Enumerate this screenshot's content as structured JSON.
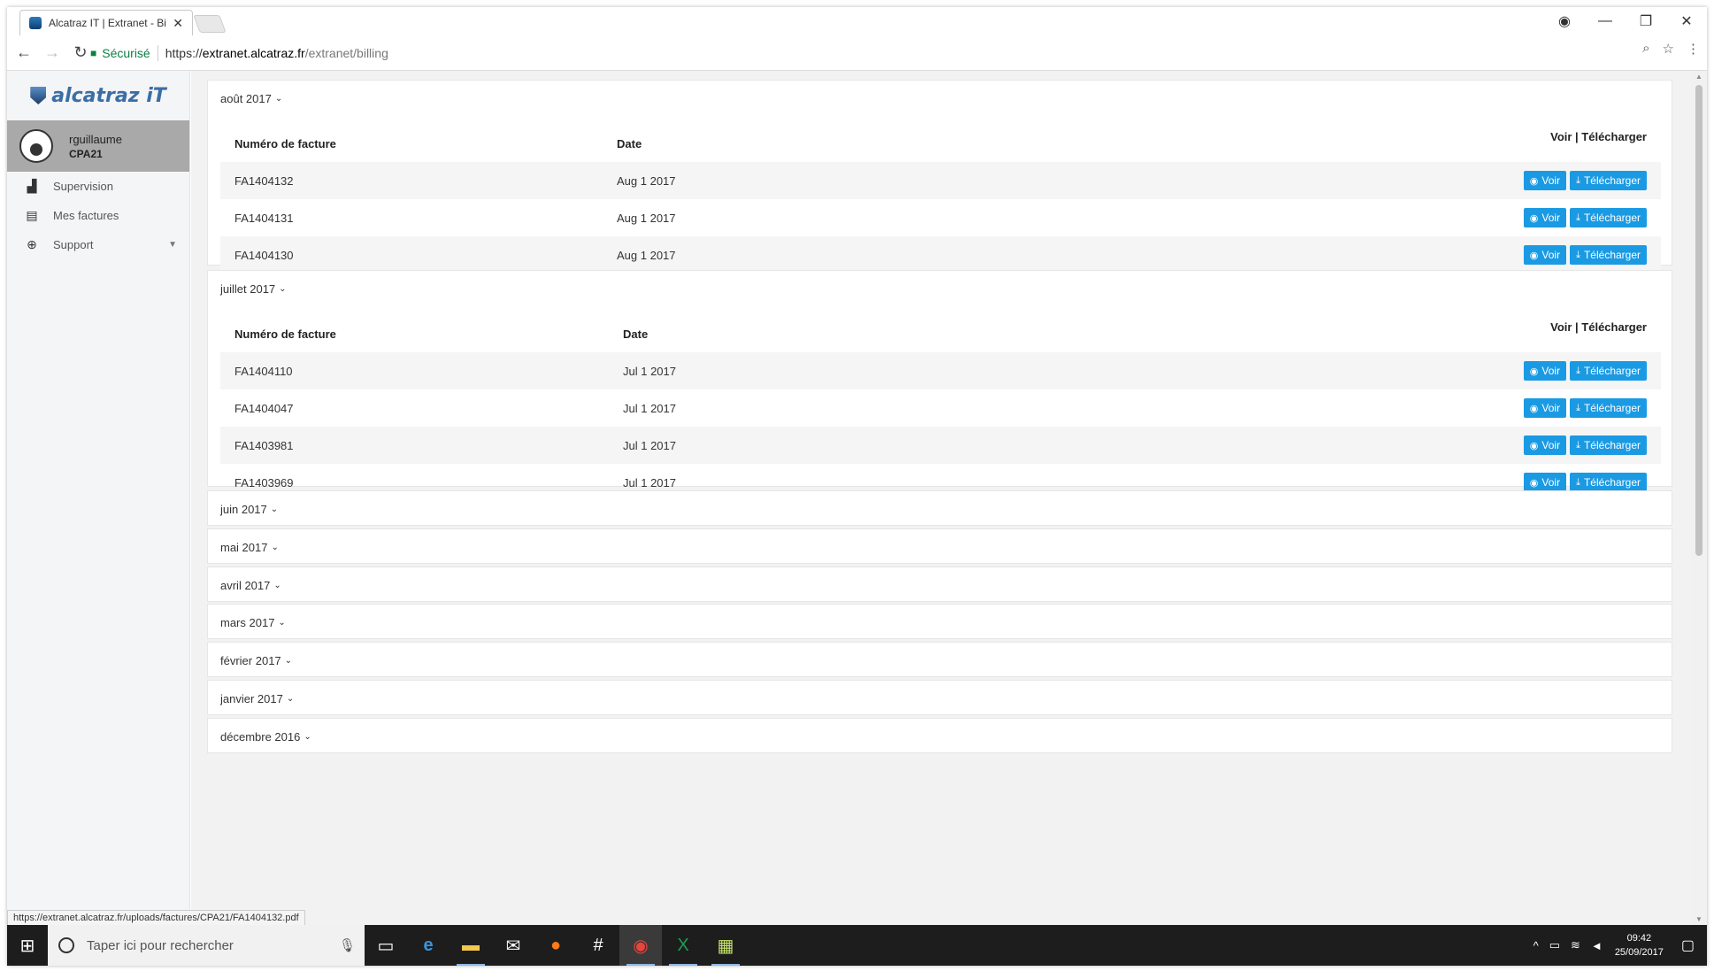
{
  "browser": {
    "tab_title": "Alcatraz IT | Extranet - Bi",
    "secure_label": "Sécurisé",
    "url_scheme": "https://",
    "url_host": "extranet.alcatraz.fr",
    "url_path": "/extranet/billing",
    "status_url": "https://extranet.alcatraz.fr/uploads/factures/CPA21/FA1404132.pdf"
  },
  "sidebar": {
    "logo": "alcatraz iT",
    "user_name": "rguillaume",
    "user_org": "CPA21",
    "items": [
      {
        "label": "Supervision",
        "icon": "area-chart-icon"
      },
      {
        "label": "Mes factures",
        "icon": "document-icon"
      },
      {
        "label": "Support",
        "icon": "lifebuoy-icon"
      }
    ]
  },
  "table": {
    "col_number": "Numéro de facture",
    "col_date": "Date",
    "col_actions": "Voir | Télécharger",
    "btn_view": "Voir",
    "btn_download": "Télécharger"
  },
  "months": [
    {
      "label": "août 2017",
      "rows": [
        {
          "number": "FA1404132",
          "date": "Aug 1 2017"
        },
        {
          "number": "FA1404131",
          "date": "Aug 1 2017"
        },
        {
          "number": "FA1404130",
          "date": "Aug 1 2017"
        }
      ]
    },
    {
      "label": "juillet 2017",
      "rows": [
        {
          "number": "FA1404110",
          "date": "Jul 1 2017"
        },
        {
          "number": "FA1404047",
          "date": "Jul 1 2017"
        },
        {
          "number": "FA1403981",
          "date": "Jul 1 2017"
        },
        {
          "number": "FA1403969",
          "date": "Jul 1 2017"
        }
      ]
    },
    {
      "label": "juin 2017"
    },
    {
      "label": "mai 2017"
    },
    {
      "label": "avril 2017"
    },
    {
      "label": "mars 2017"
    },
    {
      "label": "février 2017"
    },
    {
      "label": "janvier 2017"
    },
    {
      "label": "décembre 2016"
    }
  ],
  "taskbar": {
    "search_placeholder": "Taper ici pour rechercher",
    "time": "09:42",
    "date": "25/09/2017"
  },
  "colors": {
    "accent": "#1b9ae4"
  }
}
